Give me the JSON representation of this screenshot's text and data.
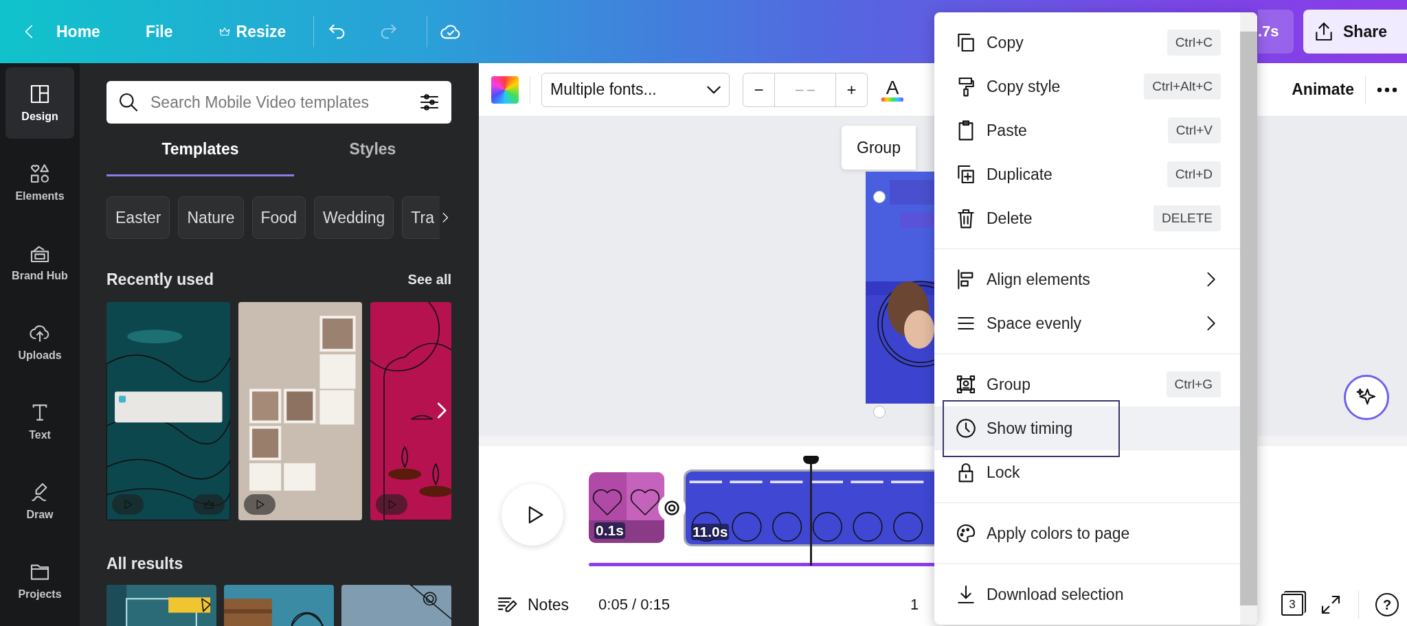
{
  "top_bar": {
    "back": "Home",
    "items": [
      {
        "kind": "file",
        "label": "File"
      },
      {
        "kind": "resize",
        "label": "Resize"
      }
    ],
    "timer_fragment": ".7s",
    "share": "Share"
  },
  "rail": [
    {
      "kind": "design",
      "label": "Design",
      "selected": true
    },
    {
      "kind": "elements",
      "label": "Elements",
      "selected": false
    },
    {
      "kind": "brand",
      "label": "Brand Hub",
      "selected": false
    },
    {
      "kind": "uploads",
      "label": "Uploads",
      "selected": false
    },
    {
      "kind": "text",
      "label": "Text",
      "selected": false
    },
    {
      "kind": "draw",
      "label": "Draw",
      "selected": false
    },
    {
      "kind": "projects",
      "label": "Projects",
      "selected": false
    }
  ],
  "panel": {
    "search": {
      "placeholder": "Search Mobile Video templates"
    },
    "tabs": [
      {
        "label": "Templates",
        "selected": true
      },
      {
        "label": "Styles",
        "selected": false
      }
    ],
    "chips": [
      "Easter",
      "Nature",
      "Food",
      "Wedding",
      "Tra"
    ],
    "recent": {
      "title": "Recently used",
      "link": "See all",
      "items": [
        {
          "kind": "picture",
          "premium": true
        },
        {
          "kind": "picture",
          "premium": false
        },
        {
          "kind": "picture",
          "premium": false
        }
      ]
    },
    "results": {
      "title": "All results",
      "items": [
        {
          "kind": "picture"
        },
        {
          "kind": "picture"
        },
        {
          "kind": "picture"
        }
      ]
    }
  },
  "toolbar": {
    "font": "Multiple fonts...",
    "decrease": "−",
    "size": "– –",
    "increase": "+",
    "text_color": "A",
    "animate": "Animate"
  },
  "canvas": {
    "group_label": "Group"
  },
  "timeline": {
    "clips": [
      {
        "duration": "0.1s",
        "selected": false
      },
      {
        "duration": "11.0s",
        "selected": true
      }
    ]
  },
  "footer": {
    "notes": "Notes",
    "time": "0:05 / 0:15",
    "zoom_fragment": "1",
    "pages": "3",
    "help": "?"
  },
  "context_menu": {
    "sections": [
      [
        {
          "kind": "copy",
          "label": "Copy",
          "shortcut": "Ctrl+C",
          "submenu": false,
          "selected": false
        },
        {
          "kind": "copy_style",
          "label": "Copy style",
          "shortcut": "Ctrl+Alt+C",
          "submenu": false,
          "selected": false
        },
        {
          "kind": "paste",
          "label": "Paste",
          "shortcut": "Ctrl+V",
          "submenu": false,
          "selected": false
        },
        {
          "kind": "duplicate",
          "label": "Duplicate",
          "shortcut": "Ctrl+D",
          "submenu": false,
          "selected": false
        },
        {
          "kind": "delete",
          "label": "Delete",
          "shortcut": "DELETE",
          "submenu": false,
          "selected": false
        }
      ],
      [
        {
          "kind": "align",
          "label": "Align elements",
          "submenu": true,
          "selected": false
        },
        {
          "kind": "space",
          "label": "Space evenly",
          "submenu": true,
          "selected": false
        }
      ],
      [
        {
          "kind": "group",
          "label": "Group",
          "shortcut": "Ctrl+G",
          "submenu": false,
          "selected": false
        },
        {
          "kind": "timing",
          "label": "Show timing",
          "submenu": false,
          "selected": true
        },
        {
          "kind": "lock",
          "label": "Lock",
          "submenu": false,
          "selected": false
        }
      ],
      [
        {
          "kind": "palette",
          "label": "Apply colors to page",
          "submenu": false,
          "selected": false
        }
      ],
      [
        {
          "kind": "download",
          "label": "Download selection",
          "submenu": false,
          "selected": false
        }
      ]
    ]
  }
}
